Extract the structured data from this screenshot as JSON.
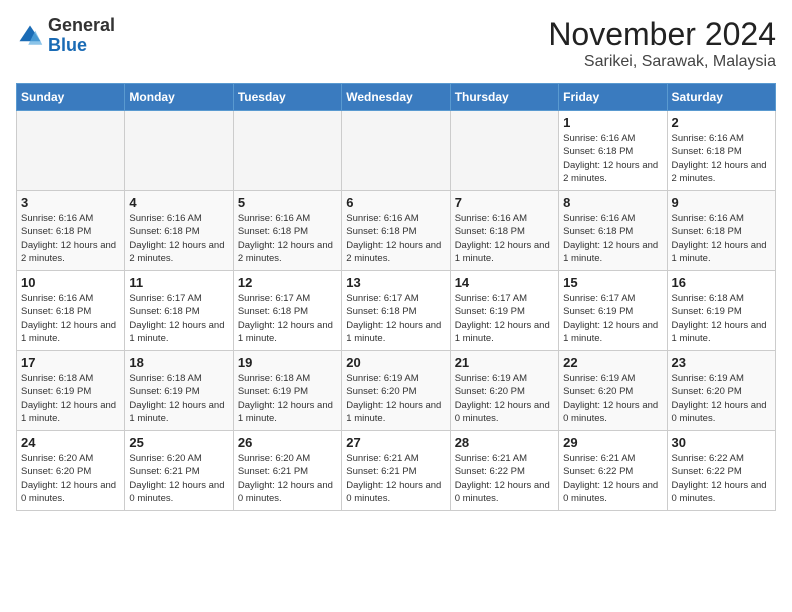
{
  "header": {
    "logo_general": "General",
    "logo_blue": "Blue",
    "month_title": "November 2024",
    "location": "Sarikei, Sarawak, Malaysia"
  },
  "weekdays": [
    "Sunday",
    "Monday",
    "Tuesday",
    "Wednesday",
    "Thursday",
    "Friday",
    "Saturday"
  ],
  "weeks": [
    [
      {
        "day": "",
        "info": ""
      },
      {
        "day": "",
        "info": ""
      },
      {
        "day": "",
        "info": ""
      },
      {
        "day": "",
        "info": ""
      },
      {
        "day": "",
        "info": ""
      },
      {
        "day": "1",
        "info": "Sunrise: 6:16 AM\nSunset: 6:18 PM\nDaylight: 12 hours and 2 minutes."
      },
      {
        "day": "2",
        "info": "Sunrise: 6:16 AM\nSunset: 6:18 PM\nDaylight: 12 hours and 2 minutes."
      }
    ],
    [
      {
        "day": "3",
        "info": "Sunrise: 6:16 AM\nSunset: 6:18 PM\nDaylight: 12 hours and 2 minutes."
      },
      {
        "day": "4",
        "info": "Sunrise: 6:16 AM\nSunset: 6:18 PM\nDaylight: 12 hours and 2 minutes."
      },
      {
        "day": "5",
        "info": "Sunrise: 6:16 AM\nSunset: 6:18 PM\nDaylight: 12 hours and 2 minutes."
      },
      {
        "day": "6",
        "info": "Sunrise: 6:16 AM\nSunset: 6:18 PM\nDaylight: 12 hours and 2 minutes."
      },
      {
        "day": "7",
        "info": "Sunrise: 6:16 AM\nSunset: 6:18 PM\nDaylight: 12 hours and 1 minute."
      },
      {
        "day": "8",
        "info": "Sunrise: 6:16 AM\nSunset: 6:18 PM\nDaylight: 12 hours and 1 minute."
      },
      {
        "day": "9",
        "info": "Sunrise: 6:16 AM\nSunset: 6:18 PM\nDaylight: 12 hours and 1 minute."
      }
    ],
    [
      {
        "day": "10",
        "info": "Sunrise: 6:16 AM\nSunset: 6:18 PM\nDaylight: 12 hours and 1 minute."
      },
      {
        "day": "11",
        "info": "Sunrise: 6:17 AM\nSunset: 6:18 PM\nDaylight: 12 hours and 1 minute."
      },
      {
        "day": "12",
        "info": "Sunrise: 6:17 AM\nSunset: 6:18 PM\nDaylight: 12 hours and 1 minute."
      },
      {
        "day": "13",
        "info": "Sunrise: 6:17 AM\nSunset: 6:18 PM\nDaylight: 12 hours and 1 minute."
      },
      {
        "day": "14",
        "info": "Sunrise: 6:17 AM\nSunset: 6:19 PM\nDaylight: 12 hours and 1 minute."
      },
      {
        "day": "15",
        "info": "Sunrise: 6:17 AM\nSunset: 6:19 PM\nDaylight: 12 hours and 1 minute."
      },
      {
        "day": "16",
        "info": "Sunrise: 6:18 AM\nSunset: 6:19 PM\nDaylight: 12 hours and 1 minute."
      }
    ],
    [
      {
        "day": "17",
        "info": "Sunrise: 6:18 AM\nSunset: 6:19 PM\nDaylight: 12 hours and 1 minute."
      },
      {
        "day": "18",
        "info": "Sunrise: 6:18 AM\nSunset: 6:19 PM\nDaylight: 12 hours and 1 minute."
      },
      {
        "day": "19",
        "info": "Sunrise: 6:18 AM\nSunset: 6:19 PM\nDaylight: 12 hours and 1 minute."
      },
      {
        "day": "20",
        "info": "Sunrise: 6:19 AM\nSunset: 6:20 PM\nDaylight: 12 hours and 1 minute."
      },
      {
        "day": "21",
        "info": "Sunrise: 6:19 AM\nSunset: 6:20 PM\nDaylight: 12 hours and 0 minutes."
      },
      {
        "day": "22",
        "info": "Sunrise: 6:19 AM\nSunset: 6:20 PM\nDaylight: 12 hours and 0 minutes."
      },
      {
        "day": "23",
        "info": "Sunrise: 6:19 AM\nSunset: 6:20 PM\nDaylight: 12 hours and 0 minutes."
      }
    ],
    [
      {
        "day": "24",
        "info": "Sunrise: 6:20 AM\nSunset: 6:20 PM\nDaylight: 12 hours and 0 minutes."
      },
      {
        "day": "25",
        "info": "Sunrise: 6:20 AM\nSunset: 6:21 PM\nDaylight: 12 hours and 0 minutes."
      },
      {
        "day": "26",
        "info": "Sunrise: 6:20 AM\nSunset: 6:21 PM\nDaylight: 12 hours and 0 minutes."
      },
      {
        "day": "27",
        "info": "Sunrise: 6:21 AM\nSunset: 6:21 PM\nDaylight: 12 hours and 0 minutes."
      },
      {
        "day": "28",
        "info": "Sunrise: 6:21 AM\nSunset: 6:22 PM\nDaylight: 12 hours and 0 minutes."
      },
      {
        "day": "29",
        "info": "Sunrise: 6:21 AM\nSunset: 6:22 PM\nDaylight: 12 hours and 0 minutes."
      },
      {
        "day": "30",
        "info": "Sunrise: 6:22 AM\nSunset: 6:22 PM\nDaylight: 12 hours and 0 minutes."
      }
    ]
  ]
}
